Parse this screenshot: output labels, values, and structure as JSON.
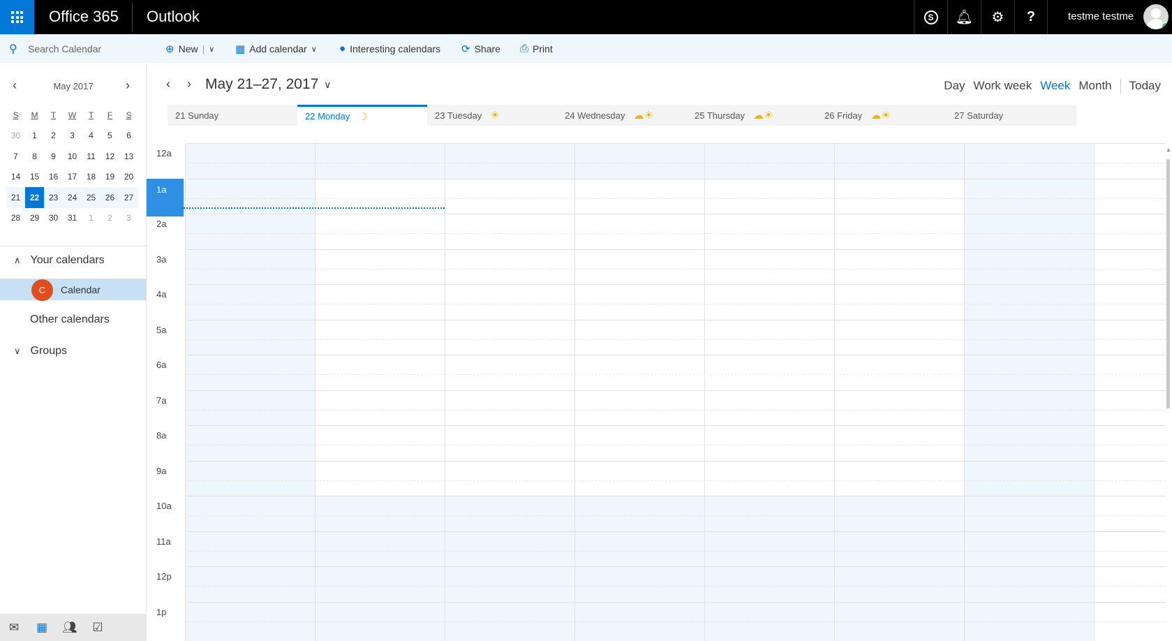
{
  "topbar": {
    "brand": "Office 365",
    "app": "Outlook",
    "user_name": "testme testme",
    "icons": [
      "skype-icon",
      "bell-icon",
      "gear-icon",
      "help-icon"
    ]
  },
  "command_bar": {
    "search_placeholder": "Search Calendar",
    "new_label": "New",
    "add_calendar_label": "Add calendar",
    "interesting_label": "Interesting calendars",
    "share_label": "Share",
    "print_label": "Print"
  },
  "mini_calendar": {
    "title": "May 2017",
    "weekdays": [
      "S",
      "M",
      "T",
      "W",
      "T",
      "F",
      "S"
    ],
    "weeks": [
      [
        "30",
        "1",
        "2",
        "3",
        "4",
        "5",
        "6"
      ],
      [
        "7",
        "8",
        "9",
        "10",
        "11",
        "12",
        "13"
      ],
      [
        "14",
        "15",
        "16",
        "17",
        "18",
        "19",
        "20"
      ],
      [
        "21",
        "22",
        "23",
        "24",
        "25",
        "26",
        "27"
      ],
      [
        "28",
        "29",
        "30",
        "31",
        "1",
        "2",
        "3"
      ]
    ],
    "selected_day": "22"
  },
  "left_pane": {
    "your_calendars": "Your calendars",
    "calendar_initial": "C",
    "calendar_name": "Calendar",
    "other_calendars": "Other calendars",
    "groups": "Groups",
    "calendar_color": "#e04e1f"
  },
  "main": {
    "range_label": "May 21–27, 2017",
    "views": {
      "day": "Day",
      "work_week": "Work week",
      "week": "Week",
      "month": "Month",
      "today": "Today"
    },
    "days": [
      {
        "label": "21 Sunday",
        "weather": ""
      },
      {
        "label": "22 Monday",
        "weather": "☽"
      },
      {
        "label": "23 Tuesday",
        "weather": "☀"
      },
      {
        "label": "24 Wednesday",
        "weather": "☁☀"
      },
      {
        "label": "25 Thursday",
        "weather": "☁☀"
      },
      {
        "label": "26 Friday",
        "weather": "☁☀"
      },
      {
        "label": "27 Saturday",
        "weather": ""
      }
    ],
    "hours": [
      "12a",
      "1a",
      "2a",
      "3a",
      "4a",
      "5a",
      "6a",
      "7a",
      "8a",
      "9a",
      "10a",
      "11a",
      "12p",
      "1p"
    ],
    "current_hour_label": "1a",
    "accent_color": "#0078d7"
  }
}
